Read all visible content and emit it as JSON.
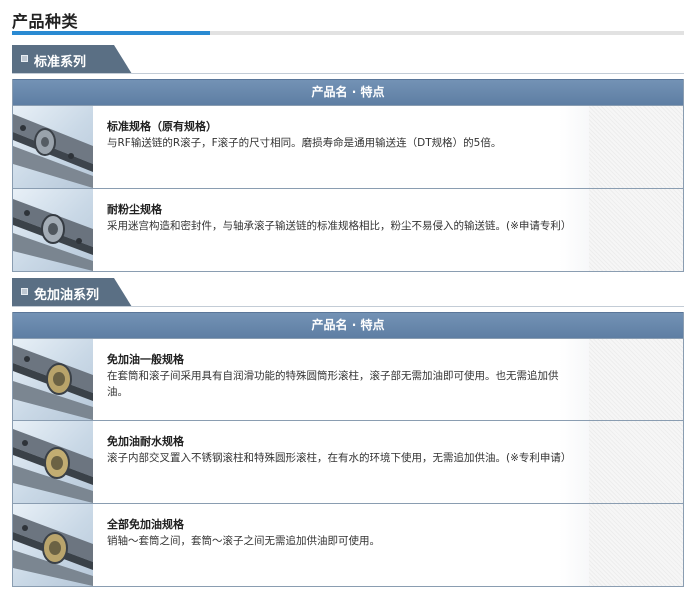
{
  "page_title": "产品种类",
  "colors": {
    "accent": "#2a8ad2",
    "series_tab": "#5a6f84",
    "table_header": "#6786ab",
    "border": "#8a9db1"
  },
  "series": [
    {
      "title": "标准系列",
      "table_header": "产品名 · 特点",
      "items": [
        {
          "name": "标准规格（原有规格）",
          "feature": "与RF输送链的R滚子，F滚子的尺寸相同。磨损寿命是通用输送连（DT规格）的5倍。",
          "image_icon": "chain-roller-image"
        },
        {
          "name": "耐粉尘规格",
          "feature": "采用迷宫构造和密封件，与轴承滚子输送链的标准规格相比，粉尘不易侵入的输送链。(※申请专利）",
          "image_icon": "chain-roller-image"
        }
      ]
    },
    {
      "title": "免加油系列",
      "table_header": "产品名 · 特点",
      "items": [
        {
          "name": "免加油一般规格",
          "feature": "在套筒和滚子间采用具有自润滑功能的特殊圆筒形滚柱，滚子部无需加油即可使用。也无需追加供油。",
          "image_icon": "chain-roller-image"
        },
        {
          "name": "免加油耐水规格",
          "feature": "滚子内部交叉置入不锈钢滚柱和特殊圆形滚柱，在有水的环境下使用，无需追加供油。(※专利申请）",
          "image_icon": "chain-roller-image"
        },
        {
          "name": "全部免加油规格",
          "feature": "销轴～套筒之间，套筒～滚子之间无需追加供油即可使用。",
          "image_icon": "chain-roller-image"
        }
      ]
    }
  ]
}
